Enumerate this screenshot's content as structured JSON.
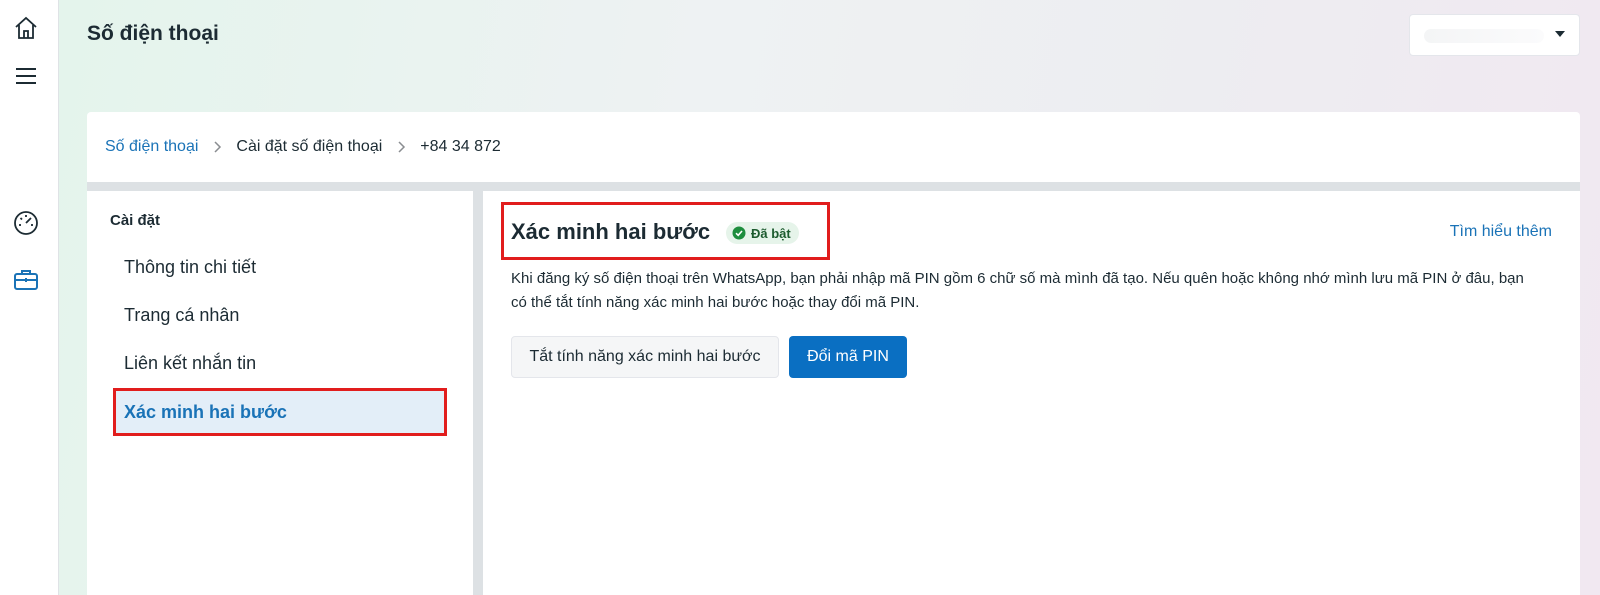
{
  "header": {
    "page_title": "Số điện thoại"
  },
  "rail": {
    "icons": [
      "home-icon",
      "menu-icon",
      "dashboard-gauge-icon",
      "briefcase-icon"
    ]
  },
  "breadcrumb": {
    "items": [
      "Số điện thoại",
      "Cài đặt số điện thoại",
      "+84 34 872"
    ]
  },
  "sidebar": {
    "heading": "Cài đặt",
    "items": [
      {
        "label": "Thông tin chi tiết"
      },
      {
        "label": "Trang cá nhân"
      },
      {
        "label": "Liên kết nhắn tin"
      },
      {
        "label": "Xác minh hai bước"
      }
    ],
    "active_index": 3
  },
  "section": {
    "title": "Xác minh hai bước",
    "status_badge": "Đã bật",
    "learn_more": "Tìm hiểu thêm",
    "description": "Khi đăng ký số điện thoại trên WhatsApp, bạn phải nhập mã PIN gồm 6 chữ số mà mình đã tạo. Nếu quên hoặc không nhớ mình lưu mã PIN ở đâu, bạn có thể tắt tính năng xác minh hai bước hoặc thay đổi mã PIN.",
    "buttons": {
      "disable": "Tắt tính năng xác minh hai bước",
      "change_pin": "Đổi mã PIN"
    }
  },
  "colors": {
    "accent": "#0a6fc2",
    "link": "#1a73b7",
    "highlight": "#e11d1d",
    "badge_bg": "#e6f4ea",
    "badge_icon": "#1e8e3e"
  }
}
